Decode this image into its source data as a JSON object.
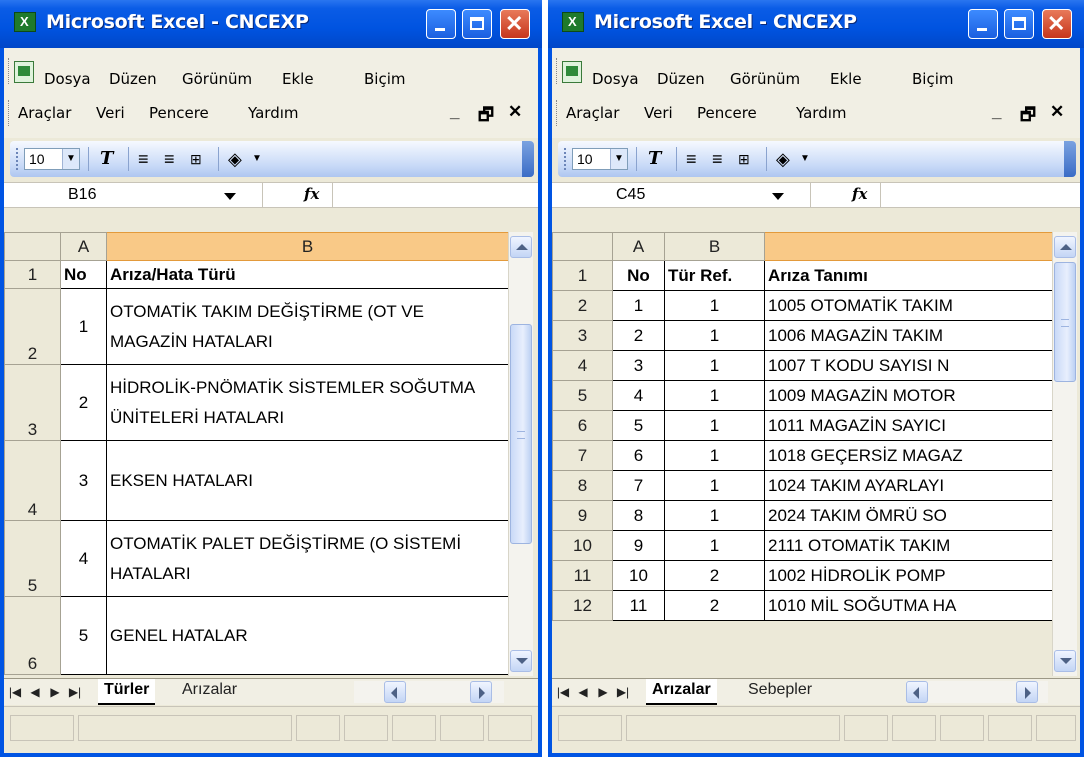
{
  "windows": [
    {
      "title": "Microsoft Excel - CNCEXP",
      "menu": [
        {
          "label": "Dosya"
        },
        {
          "label": "Düzen"
        },
        {
          "label": "Görünüm"
        },
        {
          "label": "Ekle"
        },
        {
          "label": "Biçim"
        },
        {
          "label": "Araçlar"
        },
        {
          "label": "Veri"
        },
        {
          "label": "Pencere"
        },
        {
          "label": "Yardım"
        }
      ],
      "font_size": "10",
      "name_box": "B16",
      "fx_label": "fx",
      "columns": [
        "A",
        "B"
      ],
      "rows": [
        {
          "num": "1",
          "cells": [
            "No",
            "Arıza/Hata Türü"
          ]
        },
        {
          "num": "2",
          "cells": [
            "1",
            "OTOMATİK TAKIM DEĞİŞTİRME (OT VE MAGAZİN HATALARI"
          ]
        },
        {
          "num": "3",
          "cells": [
            "2",
            "HİDROLİK-PNÖMATİK SİSTEMLER SOĞUTMA ÜNİTELERİ HATALARI"
          ]
        },
        {
          "num": "4",
          "cells": [
            "3",
            "EKSEN HATALARI"
          ]
        },
        {
          "num": "5",
          "cells": [
            "4",
            "OTOMATİK PALET DEĞİŞTİRME (O SİSTEMİ HATALARI"
          ]
        },
        {
          "num": "6",
          "cells": [
            "5",
            "GENEL HATALAR"
          ]
        }
      ],
      "sheet_tabs": [
        "Türler",
        "Arızalar"
      ],
      "active_tab": "Türler"
    },
    {
      "title": "Microsoft Excel - CNCEXP",
      "menu": [
        {
          "label": "Dosya"
        },
        {
          "label": "Düzen"
        },
        {
          "label": "Görünüm"
        },
        {
          "label": "Ekle"
        },
        {
          "label": "Biçim"
        },
        {
          "label": "Araçlar"
        },
        {
          "label": "Veri"
        },
        {
          "label": "Pencere"
        },
        {
          "label": "Yardım"
        }
      ],
      "font_size": "10",
      "name_box": "C45",
      "fx_label": "fx",
      "columns": [
        "A",
        "B",
        ""
      ],
      "rows": [
        {
          "num": "1",
          "cells": [
            "No",
            "Tür Ref.",
            "Arıza Tanımı"
          ]
        },
        {
          "num": "2",
          "cells": [
            "1",
            "1",
            "1005 OTOMATİK TAKIM"
          ]
        },
        {
          "num": "3",
          "cells": [
            "2",
            "1",
            "1006 MAGAZİN TAKIM"
          ]
        },
        {
          "num": "4",
          "cells": [
            "3",
            "1",
            "1007 T KODU SAYISI N"
          ]
        },
        {
          "num": "5",
          "cells": [
            "4",
            "1",
            "1009 MAGAZİN MOTOR"
          ]
        },
        {
          "num": "6",
          "cells": [
            "5",
            "1",
            "1011 MAGAZİN SAYICI"
          ]
        },
        {
          "num": "7",
          "cells": [
            "6",
            "1",
            "1018 GEÇERSİZ MAGAZ"
          ]
        },
        {
          "num": "8",
          "cells": [
            "7",
            "1",
            "1024 TAKIM AYARLAYI"
          ]
        },
        {
          "num": "9",
          "cells": [
            "8",
            "1",
            "2024 TAKIM ÖMRÜ SO"
          ]
        },
        {
          "num": "10",
          "cells": [
            "9",
            "1",
            "2111 OTOMATİK TAKIM"
          ]
        },
        {
          "num": "11",
          "cells": [
            "10",
            "2",
            "1002 HİDROLİK POMP"
          ]
        },
        {
          "num": "12",
          "cells": [
            "11",
            "2",
            "1010 MİL SOĞUTMA HA"
          ]
        }
      ],
      "sheet_tabs": [
        "Arızalar",
        "Sebepler"
      ],
      "active_tab": "Arızalar"
    }
  ],
  "colors": {
    "title_bar": "#0054e3",
    "selected_column_header": "#f9c987",
    "close_button": "#c6361c"
  }
}
